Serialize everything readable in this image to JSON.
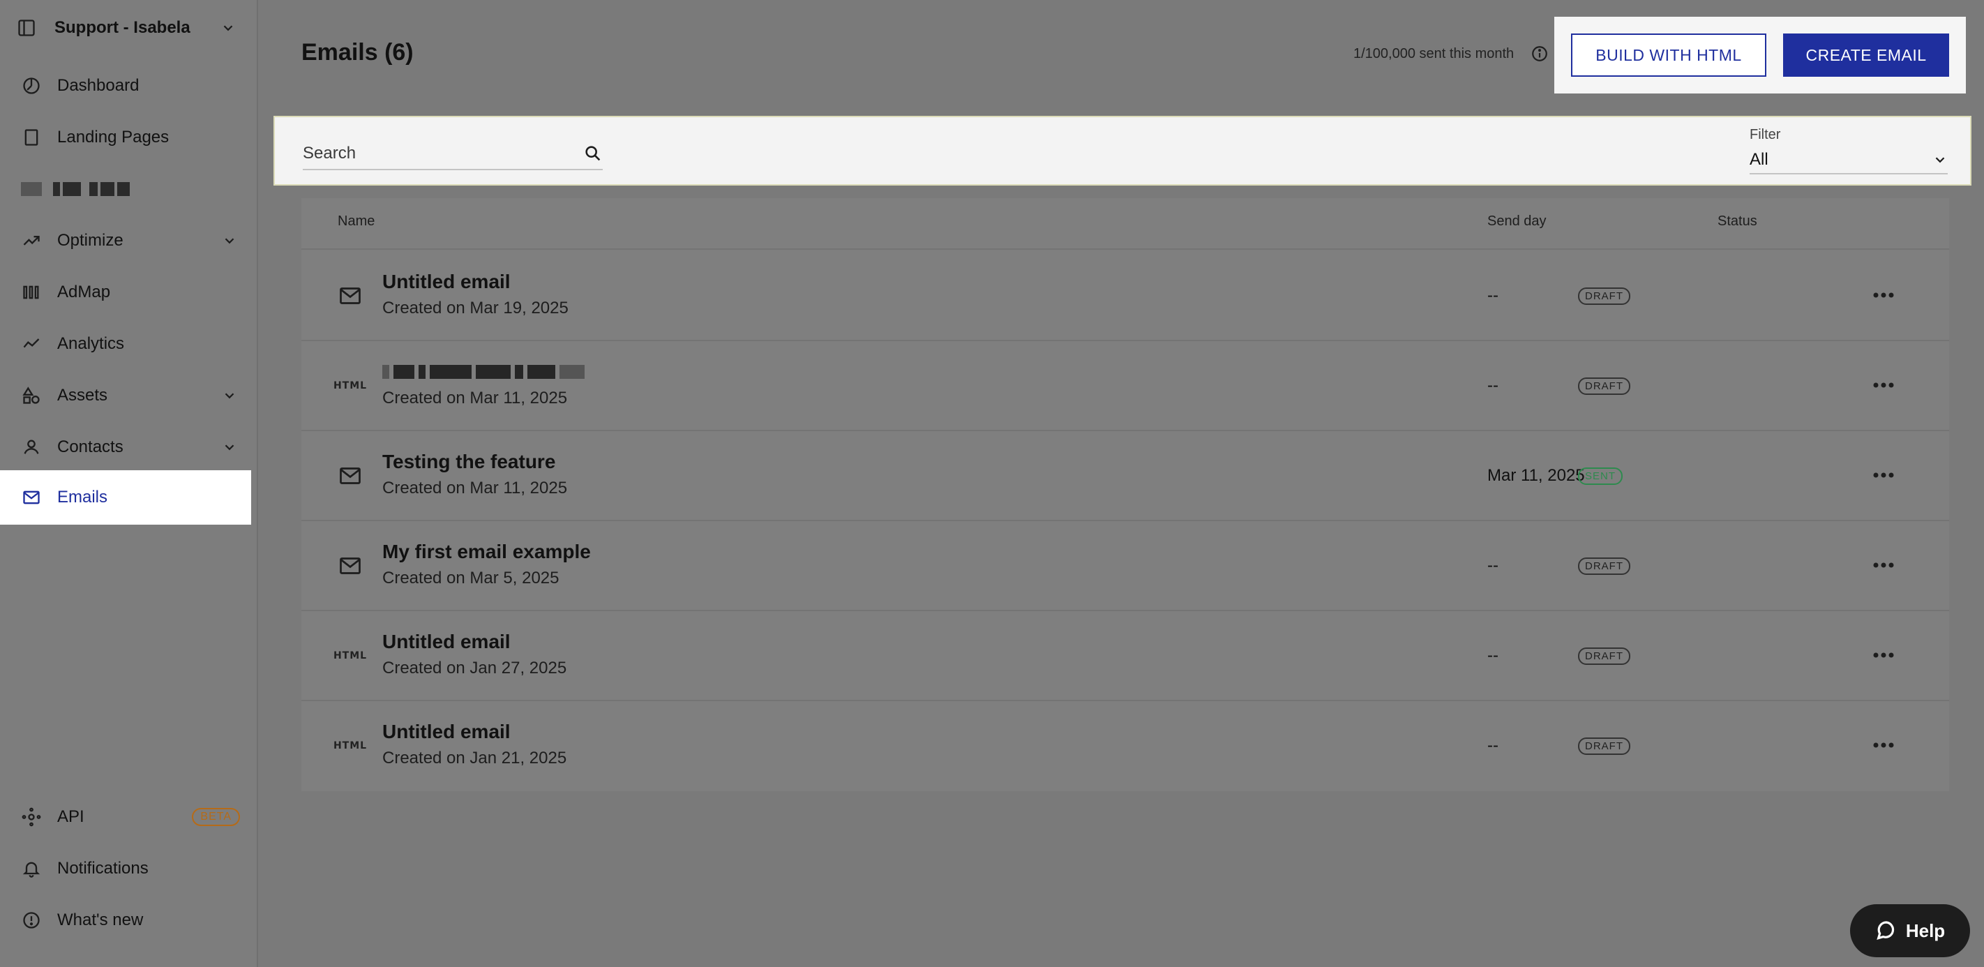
{
  "workspace": {
    "name": "Support - Isabela"
  },
  "sidebar": {
    "items": [
      {
        "label": "Dashboard"
      },
      {
        "label": "Landing Pages"
      },
      {
        "label": ""
      },
      {
        "label": "Optimize"
      },
      {
        "label": "AdMap"
      },
      {
        "label": "Analytics"
      },
      {
        "label": "Assets"
      },
      {
        "label": "Contacts"
      },
      {
        "label": "Emails"
      }
    ],
    "bottom": [
      {
        "label": "API",
        "badge": "BETA"
      },
      {
        "label": "Notifications"
      },
      {
        "label": "What's new"
      }
    ]
  },
  "header": {
    "title": "Emails (6)",
    "quota": "1/100,000 sent this month",
    "build_html_label": "BUILD WITH HTML",
    "create_email_label": "CREATE EMAIL"
  },
  "search": {
    "placeholder": "Search"
  },
  "filter": {
    "label": "Filter",
    "value": "All"
  },
  "table": {
    "columns": [
      "Name",
      "Send day",
      "Status"
    ],
    "rows": [
      {
        "type": "email",
        "name": "Untitled email",
        "created": "Created on Mar 19, 2025",
        "send_day": "--",
        "status": "DRAFT"
      },
      {
        "type": "html",
        "name": "",
        "created": "Created on Mar 11, 2025",
        "send_day": "--",
        "status": "DRAFT"
      },
      {
        "type": "email",
        "name": "Testing the feature",
        "created": "Created on Mar 11, 2025",
        "send_day": "Mar 11, 2025",
        "status": "SENT"
      },
      {
        "type": "email",
        "name": "My first email example",
        "created": "Created on Mar 5, 2025",
        "send_day": "--",
        "status": "DRAFT"
      },
      {
        "type": "html",
        "name": "Untitled email",
        "created": "Created on Jan 27, 2025",
        "send_day": "--",
        "status": "DRAFT"
      },
      {
        "type": "html",
        "name": "Untitled email",
        "created": "Created on Jan 21, 2025",
        "send_day": "--",
        "status": "DRAFT"
      }
    ]
  },
  "html_badge": "HTML",
  "help": {
    "label": "Help"
  },
  "colors": {
    "accent": "#1f2f9e",
    "sent": "#2e8a4e",
    "beta": "#b56b18"
  }
}
